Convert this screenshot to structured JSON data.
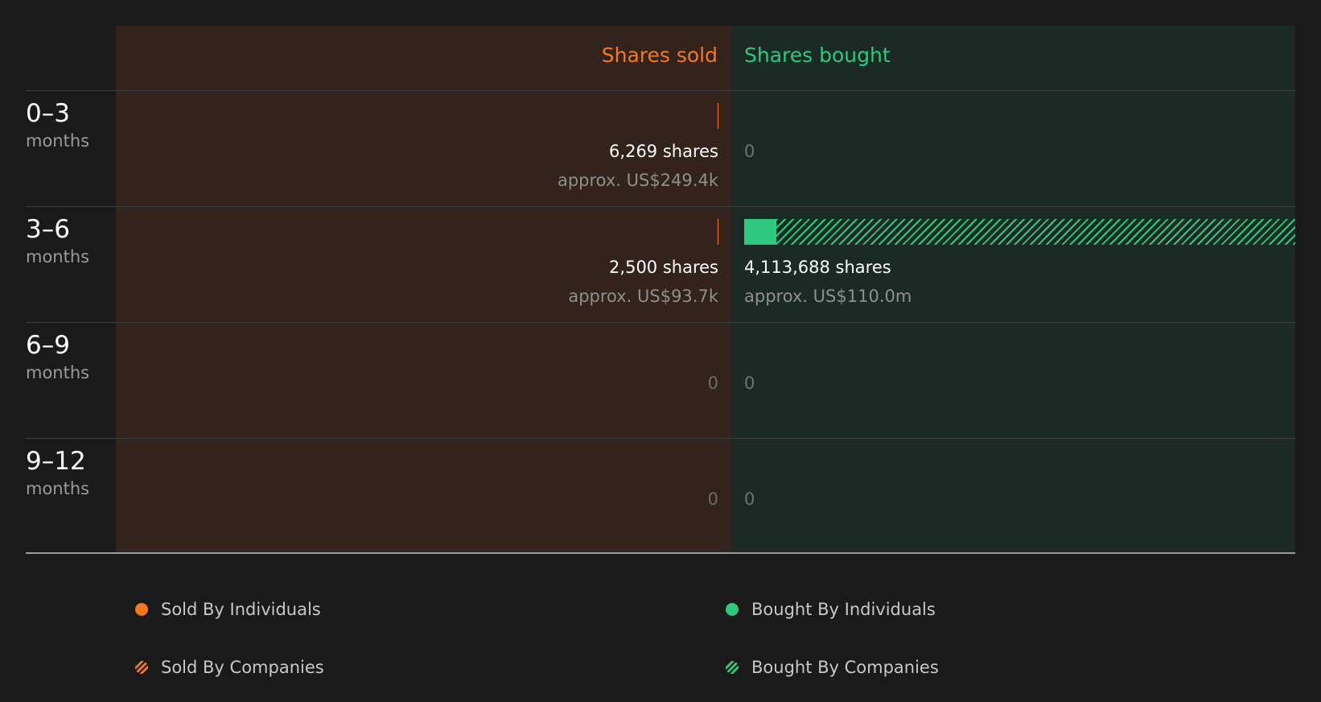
{
  "colors": {
    "sold": "#f5781e",
    "bought": "#2cc97f"
  },
  "header": {
    "sold": "Shares sold",
    "bought": "Shares bought"
  },
  "rows": [
    {
      "range": "0–3",
      "unit": "months",
      "sold_shares": "6,269 shares",
      "sold_approx": "approx. US$249.4k",
      "bought_zero": "0"
    },
    {
      "range": "3–6",
      "unit": "months",
      "sold_shares": "2,500 shares",
      "sold_approx": "approx. US$93.7k",
      "bought_shares": "4,113,688 shares",
      "bought_approx": "approx. US$110.0m"
    },
    {
      "range": "6–9",
      "unit": "months",
      "sold_zero": "0",
      "bought_zero": "0"
    },
    {
      "range": "9–12",
      "unit": "months",
      "sold_zero": "0",
      "bought_zero": "0"
    }
  ],
  "legend": [
    {
      "label": "Sold By Individuals"
    },
    {
      "label": "Bought By Individuals"
    },
    {
      "label": "Sold By Companies"
    },
    {
      "label": "Bought By Companies"
    }
  ],
  "chart_data": {
    "type": "bar",
    "categories": [
      "0–3 months",
      "3–6 months",
      "6–9 months",
      "9–12 months"
    ],
    "series": [
      {
        "name": "Sold By Individuals",
        "values": [
          6269,
          2500,
          0,
          0
        ]
      },
      {
        "name": "Sold By Companies",
        "values": [
          0,
          0,
          0,
          0
        ]
      },
      {
        "name": "Bought By Individuals",
        "values": [
          0,
          240000,
          0,
          0
        ]
      },
      {
        "name": "Bought By Companies",
        "values": [
          0,
          3873688,
          0,
          0
        ]
      }
    ],
    "max": 4113688,
    "legend": "bottom"
  }
}
